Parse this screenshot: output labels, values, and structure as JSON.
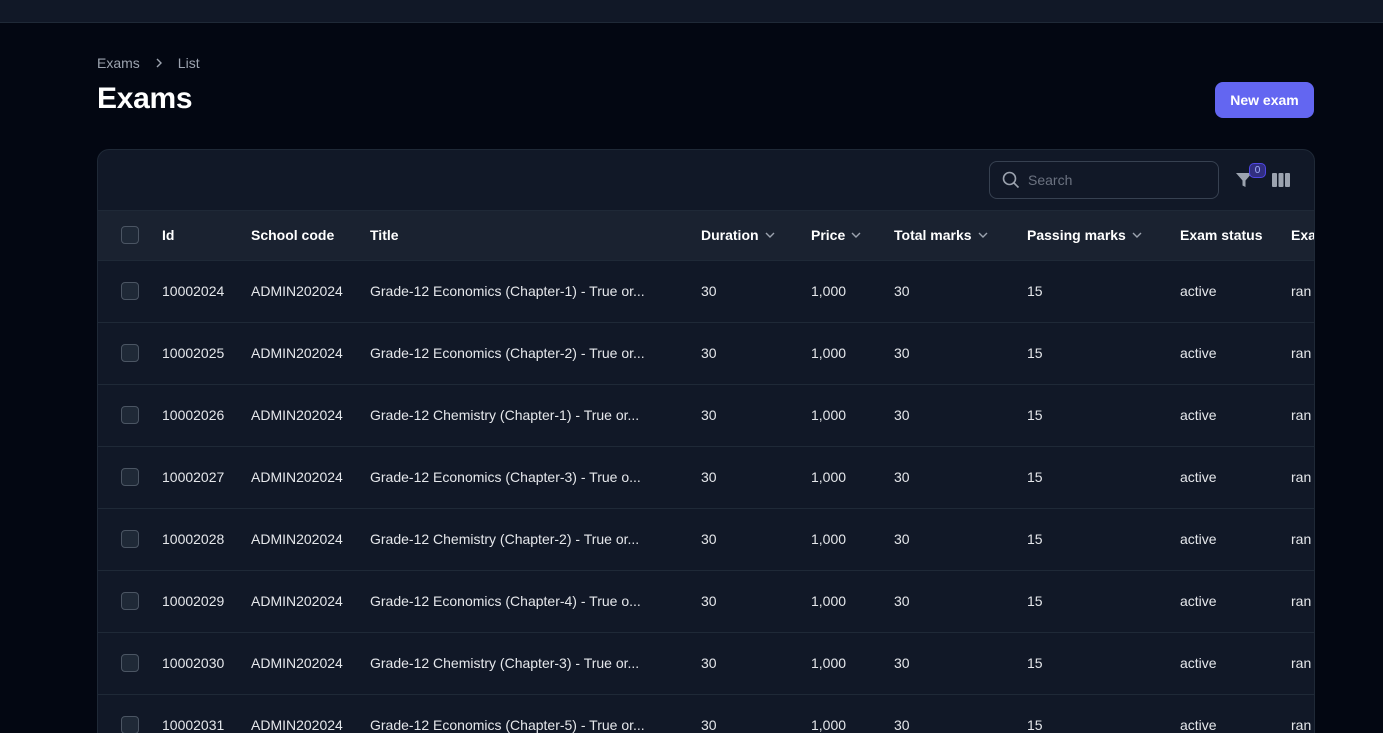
{
  "breadcrumb": {
    "parent": "Exams",
    "current": "List"
  },
  "page": {
    "title": "Exams",
    "new_button": "New exam"
  },
  "toolbar": {
    "search_placeholder": "Search",
    "filter_count": "0"
  },
  "table": {
    "columns": {
      "id": "Id",
      "school_code": "School code",
      "title": "Title",
      "duration": "Duration",
      "price": "Price",
      "total_marks": "Total marks",
      "passing_marks": "Passing marks",
      "exam_status": "Exam status",
      "exam_type": "Exa"
    },
    "rows": [
      {
        "id": "10002024",
        "school_code": "ADMIN202024",
        "title": "Grade-12 Economics (Chapter-1) - True or...",
        "duration": "30",
        "price": "1,000",
        "total_marks": "30",
        "passing_marks": "15",
        "exam_status": "active",
        "exam_type": "ran"
      },
      {
        "id": "10002025",
        "school_code": "ADMIN202024",
        "title": "Grade-12 Economics (Chapter-2) - True or...",
        "duration": "30",
        "price": "1,000",
        "total_marks": "30",
        "passing_marks": "15",
        "exam_status": "active",
        "exam_type": "ran"
      },
      {
        "id": "10002026",
        "school_code": "ADMIN202024",
        "title": "Grade-12 Chemistry (Chapter-1) - True or...",
        "duration": "30",
        "price": "1,000",
        "total_marks": "30",
        "passing_marks": "15",
        "exam_status": "active",
        "exam_type": "ran"
      },
      {
        "id": "10002027",
        "school_code": "ADMIN202024",
        "title": "Grade-12 Economics (Chapter-3) - True o...",
        "duration": "30",
        "price": "1,000",
        "total_marks": "30",
        "passing_marks": "15",
        "exam_status": "active",
        "exam_type": "ran"
      },
      {
        "id": "10002028",
        "school_code": "ADMIN202024",
        "title": "Grade-12 Chemistry (Chapter-2) - True or...",
        "duration": "30",
        "price": "1,000",
        "total_marks": "30",
        "passing_marks": "15",
        "exam_status": "active",
        "exam_type": "ran"
      },
      {
        "id": "10002029",
        "school_code": "ADMIN202024",
        "title": "Grade-12 Economics (Chapter-4) - True o...",
        "duration": "30",
        "price": "1,000",
        "total_marks": "30",
        "passing_marks": "15",
        "exam_status": "active",
        "exam_type": "ran"
      },
      {
        "id": "10002030",
        "school_code": "ADMIN202024",
        "title": "Grade-12 Chemistry (Chapter-3) - True or...",
        "duration": "30",
        "price": "1,000",
        "total_marks": "30",
        "passing_marks": "15",
        "exam_status": "active",
        "exam_type": "ran"
      },
      {
        "id": "10002031",
        "school_code": "ADMIN202024",
        "title": "Grade-12 Economics (Chapter-5) - True or...",
        "duration": "30",
        "price": "1,000",
        "total_marks": "30",
        "passing_marks": "15",
        "exam_status": "active",
        "exam_type": "ran"
      }
    ]
  },
  "colors": {
    "background": "#030712",
    "card": "#111827",
    "accent": "#6366f1"
  }
}
